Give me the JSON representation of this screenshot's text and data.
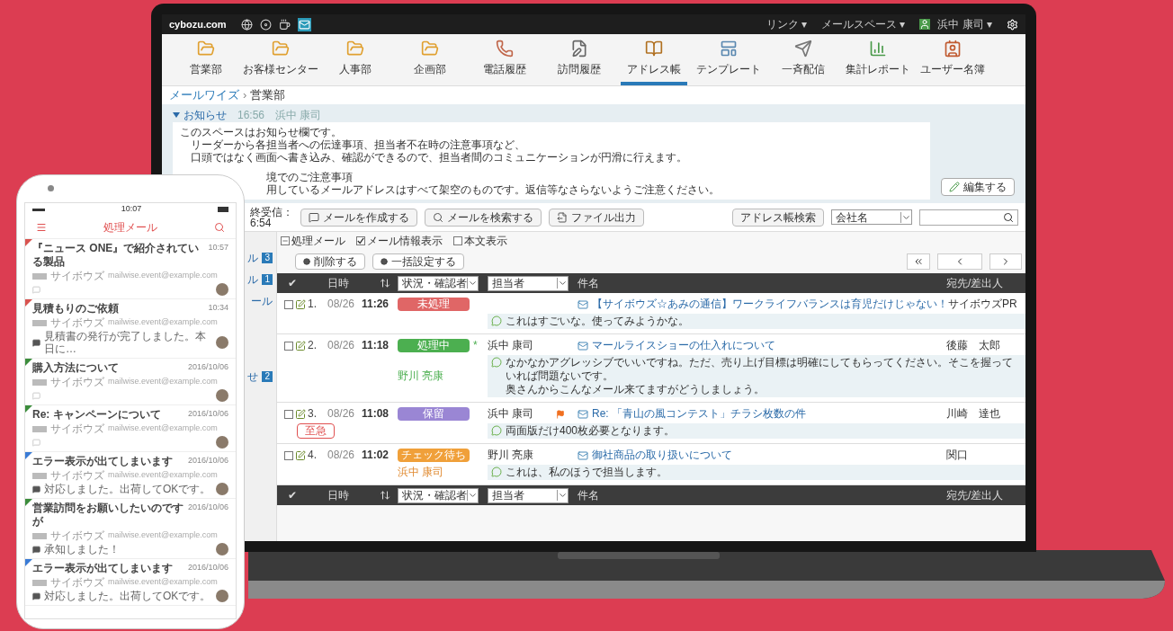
{
  "laptop": {
    "top_bar": {
      "logo": "cybozu.com",
      "menus": [
        {
          "label": "リンク ▾"
        },
        {
          "label": "メールスペース ▾"
        }
      ],
      "user": "浜中 康司 ▾"
    },
    "nav": [
      {
        "label": "営業部",
        "kind": "folder",
        "selected": false
      },
      {
        "label": "お客様センター",
        "kind": "folder",
        "selected": false
      },
      {
        "label": "人事部",
        "kind": "folder",
        "selected": false
      },
      {
        "label": "企画部",
        "kind": "folder",
        "selected": false
      },
      {
        "label": "電話履歴",
        "kind": "phone",
        "selected": false
      },
      {
        "label": "訪問履歴",
        "kind": "visit",
        "selected": false
      },
      {
        "label": "アドレス帳",
        "kind": "address",
        "selected": true
      },
      {
        "label": "テンプレート",
        "kind": "template",
        "selected": false
      },
      {
        "label": "一斉配信",
        "kind": "broadcast",
        "selected": false
      },
      {
        "label": "集計レポート",
        "kind": "report",
        "selected": false
      },
      {
        "label": "ユーザー名簿",
        "kind": "users",
        "selected": false
      }
    ],
    "breadcrumb": {
      "parent": "メールワイズ",
      "separator": "›",
      "current": "営業部"
    },
    "notice": {
      "title": "お知らせ",
      "expanded": true,
      "time": "16:56",
      "author": "浜中 康司",
      "edit_button": "編集する",
      "lines": [
        {
          "text": "このスペースはお知らせ欄です。",
          "covered": false
        },
        {
          "text": "　リーダーから各担当者への伝達事項、担当者不在時の注意事項など、",
          "covered": false
        },
        {
          "text": "　口頭ではなく画面へ書き込み、確認ができるので、担当者間のコミュニケーションが円滑に行えます。",
          "covered": false
        },
        {
          "text": "境でのご注意事項",
          "covered": true
        },
        {
          "text": "用しているメールアドレスはすべて架空のものです。返信等なさらないようご注意ください。",
          "covered": true
        }
      ]
    },
    "toolbar": {
      "last_received_label": "終受信：",
      "last_received_time": "6:54",
      "buttons": [
        {
          "label": "メールを作成する",
          "kind": "compose"
        },
        {
          "label": "メールを検索する",
          "kind": "search"
        },
        {
          "label": "ファイル出力",
          "kind": "export"
        }
      ],
      "address_search": "アドレス帳検索",
      "company_select": "会社名"
    },
    "sidebar": [
      {
        "label": "ル",
        "badge": "3"
      },
      {
        "label": "ル",
        "badge": "1"
      },
      {
        "label": "ール"
      },
      {
        "label": "せ",
        "badge": "2"
      }
    ],
    "options": [
      {
        "label": "処理メール",
        "kind": "toggle",
        "checked": true
      },
      {
        "label": "メール情報表示",
        "kind": "checkbox",
        "checked": true
      },
      {
        "label": "本文表示",
        "kind": "checkbox",
        "checked": false
      }
    ],
    "actions": [
      {
        "label": "削除する"
      },
      {
        "label": "一括設定する"
      }
    ],
    "table": {
      "headers": [
        {
          "check": "✔",
          "date": "日時",
          "status_filter": "状況・確認者",
          "assignee_filter": "担当者",
          "subject": "件名",
          "to": "宛先/差出人"
        },
        {
          "check": "✔",
          "date": "日時",
          "status_filter": "状況・確認者",
          "assignee_filter": "担当者",
          "subject": "件名",
          "to": "宛先/差出人"
        }
      ],
      "rows": [
        {
          "number": "1.",
          "checked": false,
          "date": "08/26",
          "time": "11:26",
          "status": {
            "label": "未処理",
            "color": "#e06666"
          },
          "flagged": false,
          "subject": "【サイボウズ☆あみの通信】ワークライフバランスは育児だけじゃない！",
          "to": "サイボウズPR",
          "comment": [
            "これはすごいな。使ってみようかな。"
          ]
        },
        {
          "number": "2.",
          "checked": false,
          "date": "08/26",
          "time": "11:18",
          "status": {
            "label": "処理中",
            "color": "#4caf50",
            "mark": "*"
          },
          "checker": "野川 亮康",
          "assignee": "浜中 康司",
          "flagged": false,
          "subject": "マールライスショーの仕入れについて",
          "to": "後藤　太郎",
          "comment": [
            "なかなかアグレッシブでいいですね。ただ、売り上げ目標は明確にしてもらってください。そこを握っていれば問題ないです。",
            "奥さんからこんなメール来てますがどうしましょう。"
          ]
        },
        {
          "number": "3.",
          "checked": false,
          "date": "08/26",
          "time": "11:08",
          "status": {
            "label": "保留",
            "color": "#9a86d4"
          },
          "tag": "至急",
          "assignee": "浜中 康司",
          "flagged": true,
          "subject": "Re: 「青山の風コンテスト」チラシ枚数の件",
          "to": "川崎　達也",
          "comment": [
            "両面版だけ400枚必要となります。"
          ]
        },
        {
          "number": "4.",
          "checked": false,
          "date": "08/26",
          "time": "11:02",
          "status": {
            "label": "チェック待ち",
            "color": "#f0a03a"
          },
          "checker": "浜中 康司",
          "assignee": "野川 亮康",
          "flagged": false,
          "subject": "御社商品の取り扱いについて",
          "to": "関口",
          "comment": [
            "これは、私のほうで担当します。"
          ]
        }
      ]
    }
  },
  "phone": {
    "status_time": "10:07",
    "title": "処理メール",
    "items": [
      {
        "color": "#d9534f",
        "title": "『ニュース ONE』で紹介されている製品",
        "time": "10:57",
        "sender": "サイボウズ",
        "email": "mailwise.event@example.com"
      },
      {
        "color": "#d9534f",
        "title": "見積もりのご依頼",
        "time": "10:34",
        "sender": "サイボウズ",
        "email": "mailwise.event@example.com",
        "comment": "見積書の発行が完了しました。本日に…"
      },
      {
        "color": "#3c8d3c",
        "title": "購入方法について",
        "time": "2016/10/06",
        "sender": "サイボウズ",
        "email": "mailwise.event@example.com"
      },
      {
        "color": "#3c8d3c",
        "title": "Re: キャンペーンについて",
        "time": "2016/10/06",
        "sender": "サイボウズ",
        "email": "mailwise.event@example.com"
      },
      {
        "color": "#3a7bd5",
        "title": "エラー表示が出てしまいます",
        "time": "2016/10/06",
        "sender": "サイボウズ",
        "email": "mailwise.event@example.com",
        "comment": "対応しました。出荷してOKです。"
      },
      {
        "color": "#3c8d3c",
        "title": "営業訪問をお願いしたいのですが",
        "time": "2016/10/06",
        "sender": "サイボウズ",
        "email": "mailwise.event@example.com",
        "comment": "承知しました！"
      },
      {
        "color": "#3a7bd5",
        "title": "エラー表示が出てしまいます",
        "time": "2016/10/06",
        "sender": "サイボウズ",
        "email": "mailwise.event@example.com",
        "comment": "対応しました。出荷してOKです。"
      }
    ]
  }
}
